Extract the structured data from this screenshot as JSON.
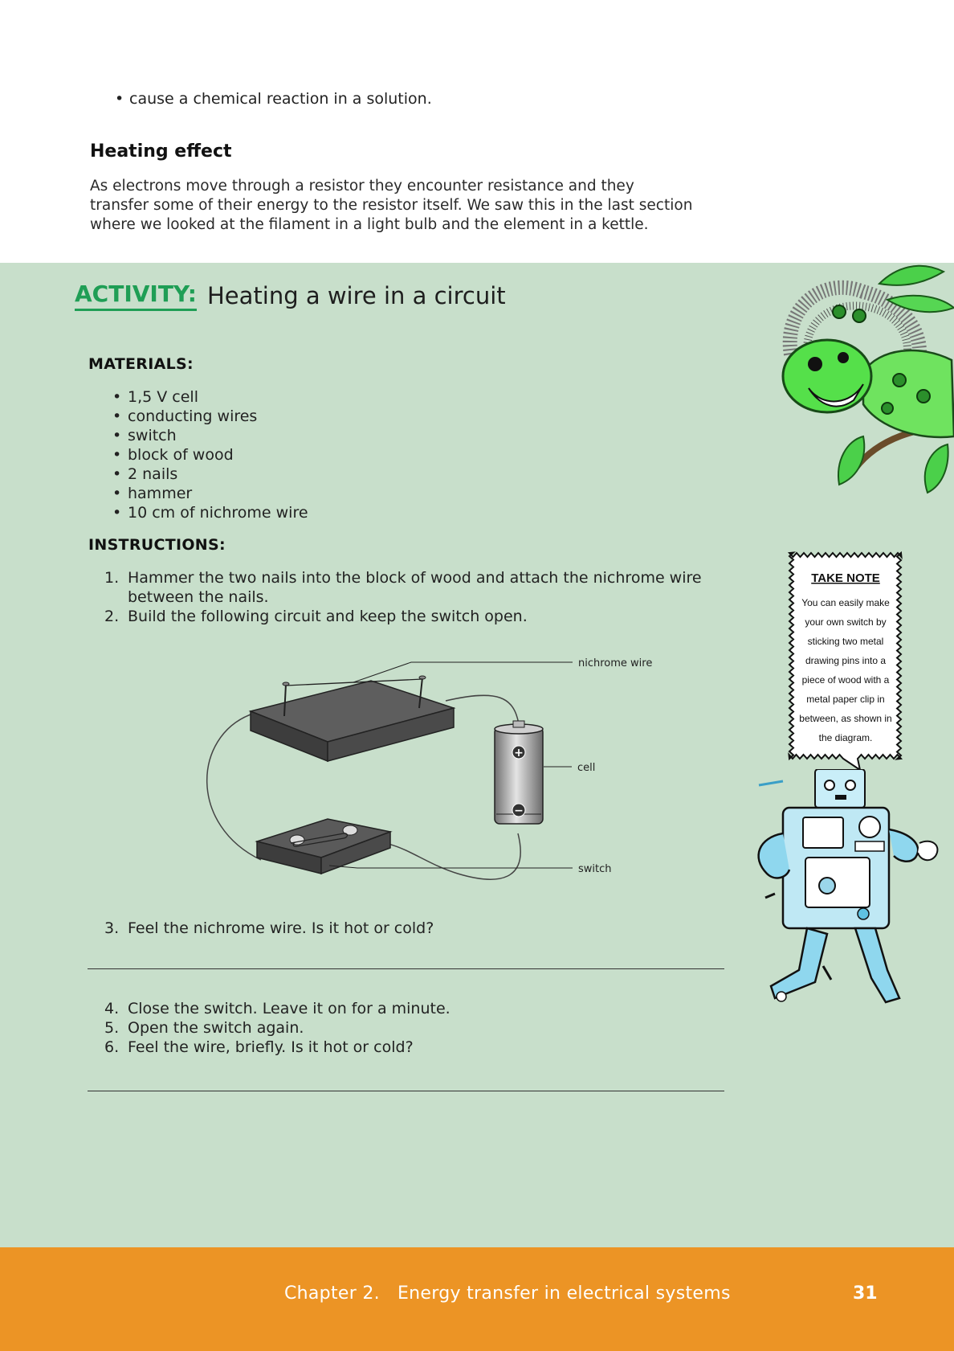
{
  "top_bullet": "cause a chemical reaction in a solution.",
  "section_heading": "Heating effect",
  "paragraph": [
    "As electrons move through a resistor they encounter resistance and they",
    "transfer some of their energy to the resistor itself. We saw this in the last section",
    "where we looked at the filament in a light bulb and the element in a kettle."
  ],
  "activity": {
    "label": "ACTIVITY:",
    "title": "Heating a wire in a circuit",
    "materials_heading": "MATERIALS:",
    "materials": [
      "1,5 V cell",
      "conducting wires",
      "switch",
      "block of wood",
      "2 nails",
      "hammer",
      "10 cm of nichrome wire"
    ],
    "instructions_heading": "INSTRUCTIONS:",
    "steps_a": [
      {
        "num": "1.",
        "text": "Hammer the two nails into the block of wood and attach the nichrome wire between the nails."
      },
      {
        "num": "2.",
        "text": "Build the following circuit and keep the switch open."
      }
    ],
    "step_3": {
      "num": "3.",
      "text": "Feel the nichrome wire. Is it hot or cold?"
    },
    "steps_b": [
      {
        "num": "4.",
        "text": "Close the switch. Leave it on for a minute."
      },
      {
        "num": "5.",
        "text": "Open the switch again."
      },
      {
        "num": "6.",
        "text": "Feel the wire, briefly. Is it hot or cold?"
      }
    ]
  },
  "diagram": {
    "nichrome_label": "nichrome wire",
    "cell_label": "cell",
    "switch_label": "switch"
  },
  "take_note": {
    "title": "TAKE NOTE",
    "lines": [
      "You can easily make",
      "your own switch by",
      "sticking two metal",
      "drawing pins into a",
      "piece of wood with a",
      "metal paper clip in",
      "between, as shown in",
      "the diagram."
    ]
  },
  "footer": {
    "chapter": "Chapter 2.",
    "chapter_title": "Energy transfer in electrical systems",
    "page": "31"
  },
  "colors": {
    "activity_bg": "#c8dfcb",
    "activity_accent": "#1f9e55",
    "footer_bg": "#ec9425"
  }
}
